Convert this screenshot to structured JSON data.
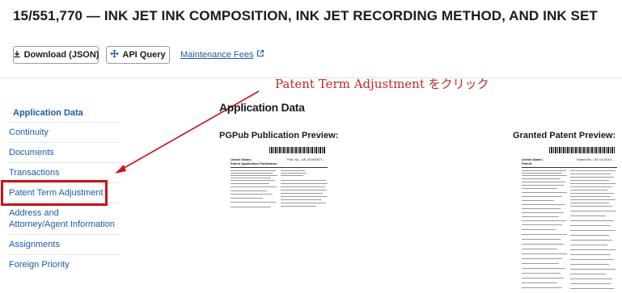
{
  "page": {
    "title": "15/551,770 — INK JET INK COMPOSITION, INK JET RECORDING METHOD, AND INK SET"
  },
  "toolbar": {
    "download_label": "Download (JSON)",
    "api_label": "API Query",
    "maintenance_label": "Maintenance Fees"
  },
  "annotation": {
    "text": "Patent Term Adjustment をクリック",
    "color": "#c62828"
  },
  "sidebar": {
    "heading": "Application Data",
    "items": [
      {
        "label": "Continuity"
      },
      {
        "label": "Documents"
      },
      {
        "label": "Transactions"
      },
      {
        "label": "Patent Term Adjustment"
      },
      {
        "label": "Address and"
      },
      {
        "label": "Attorney/Agent Information"
      },
      {
        "label": "Assignments"
      },
      {
        "label": "Foreign Priority"
      }
    ]
  },
  "main": {
    "heading": "Application Data",
    "pgpub_label": "PGPub Publication Preview:",
    "granted_label": "Granted Patent Preview:"
  },
  "previews": {
    "pgpub": {
      "head1": "United States",
      "head2": "Patent Application Publication",
      "pub_no": "Pub. No.: US 2019/0077..."
    },
    "granted": {
      "head1": "United States",
      "head2": "Patent",
      "pat_no": "Patent No.: US 10,519,3..."
    }
  },
  "colors": {
    "link": "#1a5ca8",
    "highlight": "#d0101a"
  },
  "icons": {
    "download": "download-icon",
    "api": "api-move-icon",
    "external": "external-link-icon"
  }
}
